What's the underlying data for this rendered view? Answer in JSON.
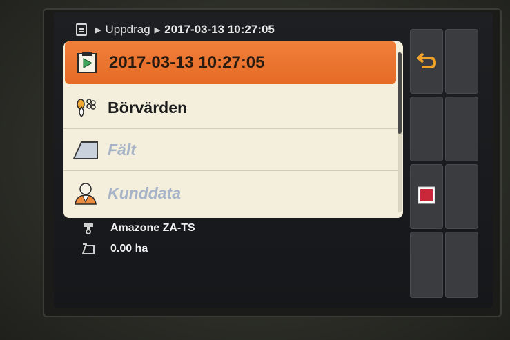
{
  "breadcrumb": {
    "items": [
      "Uppdrag",
      "2017-03-13 10:27:05"
    ]
  },
  "list": {
    "items": [
      {
        "label": "2017-03-13 10:27:05",
        "icon": "task-play-icon",
        "state": "selected"
      },
      {
        "label": "Börvärden",
        "icon": "setpoint-drops-icon",
        "state": "enabled"
      },
      {
        "label": "Fält",
        "icon": "field-icon",
        "state": "disabled"
      },
      {
        "label": "Kunddata",
        "icon": "customer-icon",
        "state": "disabled"
      }
    ],
    "scroll_fraction": 0.5
  },
  "info": {
    "machine": "Amazone ZA-TS",
    "area": "0.00 ha"
  },
  "softkeys": [
    {
      "row": 1,
      "col": 1,
      "icon": "back-arrow-icon"
    },
    {
      "row": 3,
      "col": 1,
      "icon": "stop-icon"
    }
  ],
  "colors": {
    "accent": "#ea742f",
    "panel": "#f3efdc",
    "disabled_text": "#a7b4c8",
    "stop": "#c8283a"
  }
}
